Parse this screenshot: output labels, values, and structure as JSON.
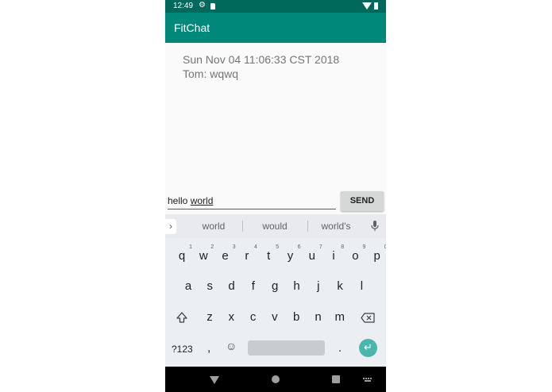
{
  "status_bar": {
    "time": "12:49",
    "icons": [
      "gear-icon",
      "sd-card-icon",
      "wifi-icon",
      "battery-icon"
    ]
  },
  "app": {
    "title": "FitChat",
    "primary_color": "#00897b",
    "status_color": "#00695c"
  },
  "messages": [
    {
      "timestamp": "Sun Nov 04 11:06:33 CST 2018",
      "text": "Tom: wqwq"
    }
  ],
  "composer": {
    "value_plain": "hello ",
    "value_underlined": "world",
    "send_label": "SEND",
    "underline_color": "#d81b60"
  },
  "keyboard": {
    "suggestions": [
      "world",
      "would",
      "world's"
    ],
    "rows": [
      [
        {
          "k": "q",
          "h": "1"
        },
        {
          "k": "w",
          "h": "2"
        },
        {
          "k": "e",
          "h": "3"
        },
        {
          "k": "r",
          "h": "4"
        },
        {
          "k": "t",
          "h": "5"
        },
        {
          "k": "y",
          "h": "6"
        },
        {
          "k": "u",
          "h": "7"
        },
        {
          "k": "i",
          "h": "8"
        },
        {
          "k": "o",
          "h": "9"
        },
        {
          "k": "p",
          "h": "0"
        }
      ],
      [
        {
          "k": "a"
        },
        {
          "k": "s"
        },
        {
          "k": "d"
        },
        {
          "k": "f"
        },
        {
          "k": "g"
        },
        {
          "k": "h"
        },
        {
          "k": "j"
        },
        {
          "k": "k"
        },
        {
          "k": "l"
        }
      ],
      [
        {
          "k": "z"
        },
        {
          "k": "x"
        },
        {
          "k": "c"
        },
        {
          "k": "v"
        },
        {
          "k": "b"
        },
        {
          "k": "n"
        },
        {
          "k": "m"
        }
      ]
    ],
    "symbols_label": "?123",
    "comma": ",",
    "period": ".",
    "enter_color": "#4db6ac"
  }
}
